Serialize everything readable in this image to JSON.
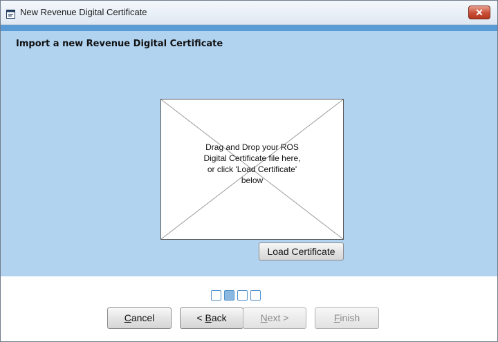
{
  "window": {
    "title": "New Revenue Digital Certificate",
    "icons": {
      "app": "certificate-app-icon",
      "close": "close-icon"
    },
    "close_glyph": "✕"
  },
  "page": {
    "heading": "Import a new Revenue Digital Certificate"
  },
  "drop_zone": {
    "text": "Drag and Drop your ROS Digital Certificate file here, or click 'Load Certificate' below"
  },
  "buttons": {
    "load_certificate": "Load Certificate",
    "cancel": {
      "mnemonic": "C",
      "rest": "ancel"
    },
    "back": {
      "prefix": "< ",
      "mnemonic": "B",
      "rest": "ack"
    },
    "next": {
      "mnemonic": "N",
      "rest": "ext >"
    },
    "finish": {
      "mnemonic": "F",
      "rest": "inish"
    }
  },
  "wizard": {
    "total_steps": 4,
    "current_step": 2
  },
  "colors": {
    "accent": "#5b9bd5",
    "content_background": "#b1d3f0",
    "step_active": "#8ab8e0",
    "close_button": "#c94f36"
  }
}
